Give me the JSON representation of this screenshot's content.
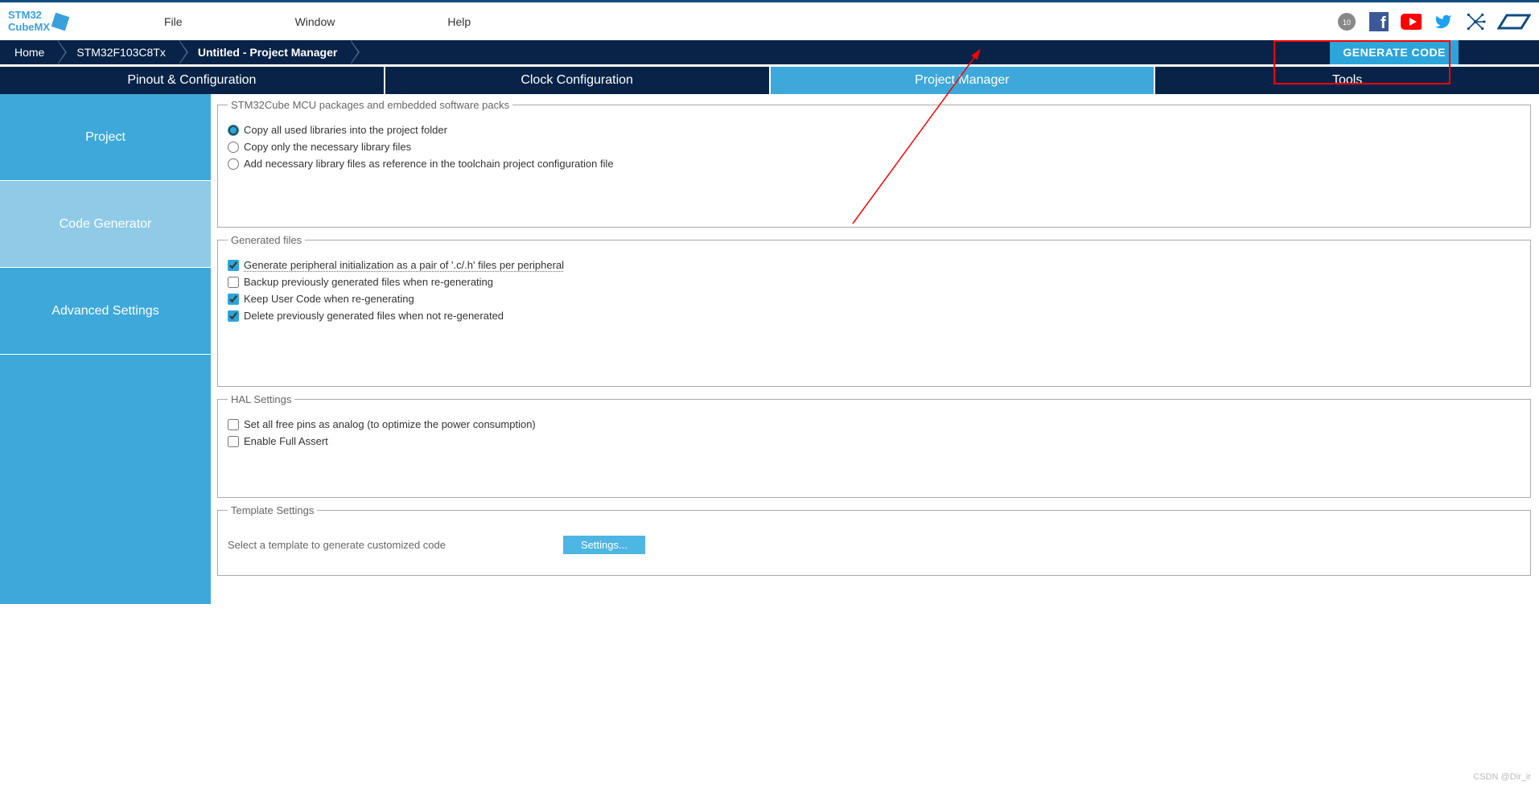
{
  "topbar": {
    "logo_line1": "STM32",
    "logo_line2": "CubeMX",
    "menu": {
      "file": "File",
      "window": "Window",
      "help": "Help"
    }
  },
  "breadcrumb": {
    "home": "Home",
    "chip": "STM32F103C8Tx",
    "page": "Untitled - Project Manager",
    "generate": "GENERATE CODE"
  },
  "main_tabs": {
    "pinout": "Pinout & Configuration",
    "clock": "Clock Configuration",
    "pm": "Project Manager",
    "tools": "Tools"
  },
  "sidebar": {
    "project": "Project",
    "codegen": "Code Generator",
    "advanced": "Advanced Settings"
  },
  "packages": {
    "legend": "STM32Cube MCU packages and embedded software packs",
    "opt_copy_all": "Copy all used libraries into the project folder",
    "opt_copy_necessary": "Copy only the necessary library files",
    "opt_add_ref": "Add necessary library files as reference in the toolchain project configuration file"
  },
  "generated": {
    "legend": "Generated files",
    "periph": "Generate peripheral initialization as a pair of '.c/.h' files per peripheral",
    "backup": "Backup previously generated files when re-generating",
    "keep": "Keep User Code when re-generating",
    "delete": "Delete previously generated files when not re-generated"
  },
  "hal": {
    "legend": "HAL Settings",
    "analog": "Set all free pins as analog (to optimize the power consumption)",
    "assert": "Enable Full Assert"
  },
  "template": {
    "legend": "Template Settings",
    "prompt": "Select a template to generate customized code",
    "button": "Settings..."
  },
  "watermark": "CSDN @Dir_ir"
}
